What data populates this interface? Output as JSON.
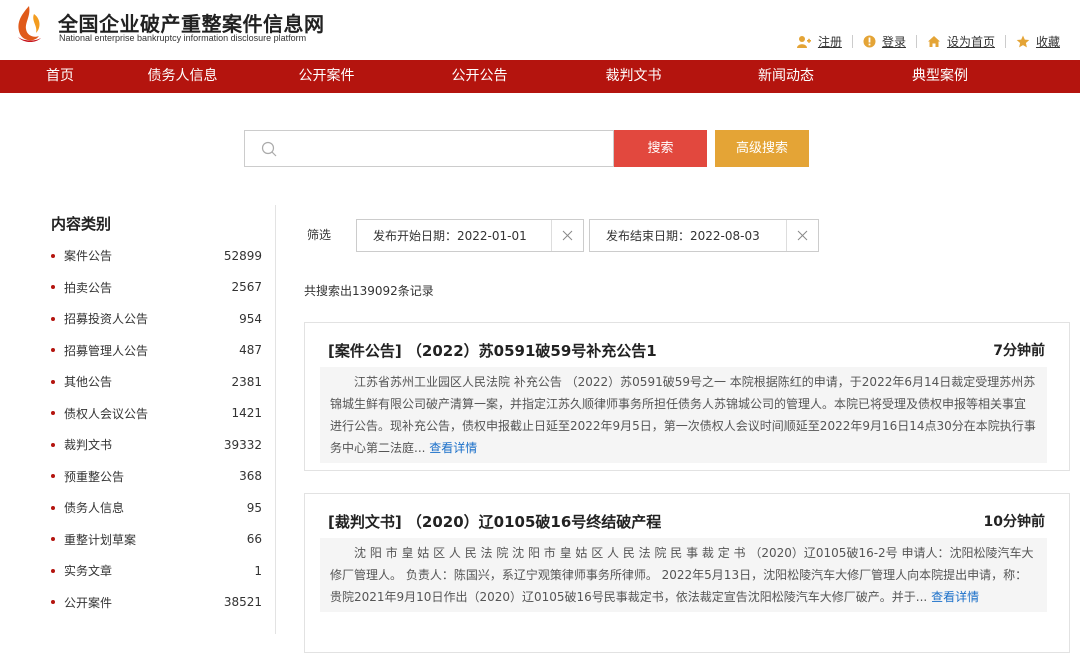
{
  "site": {
    "title": "全国企业破产重整案件信息网",
    "subtitle": "National enterprise bankruptcy information disclosure platform",
    "logo_icon": "flame-logo-icon"
  },
  "toplinks": [
    {
      "label": "注册",
      "icon": "register-icon"
    },
    {
      "label": "登录",
      "icon": "login-icon"
    },
    {
      "label": "设为首页",
      "icon": "home-icon"
    },
    {
      "label": "收藏",
      "icon": "star-icon"
    }
  ],
  "nav": [
    "首页",
    "债务人信息",
    "公开案件",
    "公开公告",
    "裁判文书",
    "新闻动态",
    "典型案例"
  ],
  "search": {
    "placeholder": "",
    "button": "搜索",
    "advanced_button": "高级搜索"
  },
  "sidebar": {
    "title": "内容类别",
    "categories": [
      {
        "label": "案件公告",
        "count": "52899"
      },
      {
        "label": "拍卖公告",
        "count": "2567"
      },
      {
        "label": "招募投资人公告",
        "count": "954"
      },
      {
        "label": "招募管理人公告",
        "count": "487"
      },
      {
        "label": "其他公告",
        "count": "2381"
      },
      {
        "label": "债权人会议公告",
        "count": "1421"
      },
      {
        "label": "裁判文书",
        "count": "39332"
      },
      {
        "label": "预重整公告",
        "count": "368"
      },
      {
        "label": "债务人信息",
        "count": "95"
      },
      {
        "label": "重整计划草案",
        "count": "66"
      },
      {
        "label": "实务文章",
        "count": "1"
      },
      {
        "label": "公开案件",
        "count": "38521"
      }
    ]
  },
  "filter": {
    "label": "筛选",
    "chips": [
      "发布开始日期：2022-01-01",
      "发布结束日期：2022-08-03"
    ]
  },
  "result_count": "共搜索出139092条记录",
  "results": [
    {
      "title": "[案件公告] （2022）苏0591破59号补充公告1",
      "time": "7分钟前",
      "body": "江苏省苏州工业园区人民法院 补充公告 （2022）苏0591破59号之一 本院根据陈红的申请，于2022年6月14日裁定受理苏州苏锦城生鲜有限公司破产清算一案，并指定江苏久顺律师事务所担任债务人苏锦城公司的管理人。本院已将受理及债权申报等相关事宜进行公告。现补充公告，债权申报截止日延至2022年9月5日，第一次债权人会议时间顺延至2022年9月16日14点30分在本院执行事务中心第二法庭...",
      "more": "查看详情"
    },
    {
      "title": "[裁判文书] （2020）辽0105破16号终结破产程",
      "time": "10分钟前",
      "body": "沈 阳 市 皇 姑 区 人 民 法 院 沈 阳 市 皇 姑 区 人 民 法 院 民 事 裁 定 书 （2020）辽0105破16-2号 申请人：沈阳松陵汽车大修厂管理人。 负责人：陈国兴，系辽宁观策律师事务所律师。 2022年5月13日，沈阳松陵汽车大修厂管理人向本院提出申请，称：贵院2021年9月10日作出（2020）辽0105破16号民事裁定书，依法裁定宣告沈阳松陵汽车大修厂破产。并于...",
      "more": "查看详情"
    }
  ],
  "colors": {
    "nav_bg": "#b4140e",
    "search_button": "#e2483e",
    "advanced_button": "#e4a436",
    "link": "#1a6fc9"
  }
}
